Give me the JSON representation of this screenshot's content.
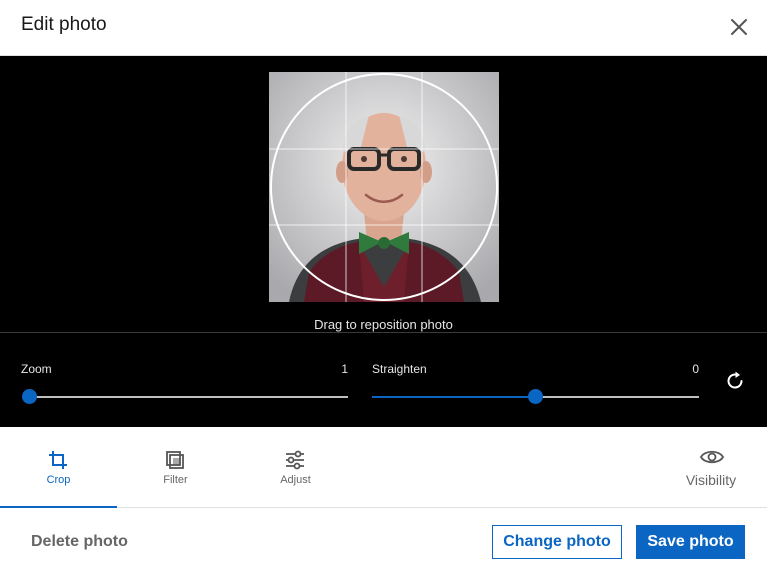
{
  "header": {
    "title": "Edit photo",
    "close_icon": "close-icon"
  },
  "editor": {
    "drag_hint": "Drag to reposition photo",
    "zoom": {
      "label": "Zoom",
      "value": "1",
      "fraction": 0.0
    },
    "straighten": {
      "label": "Straighten",
      "value": "0",
      "fraction": 0.5
    },
    "reset_icon": "rotate-reset-icon"
  },
  "tabs": {
    "items": [
      {
        "label": "Crop",
        "icon": "crop-icon",
        "active": true
      },
      {
        "label": "Filter",
        "icon": "filter-icon",
        "active": false
      },
      {
        "label": "Adjust",
        "icon": "adjust-sliders-icon",
        "active": false
      }
    ],
    "visibility": {
      "label": "Visibility",
      "icon": "eye-icon"
    }
  },
  "footer": {
    "delete_label": "Delete photo",
    "change_label": "Change photo",
    "save_label": "Save photo"
  },
  "colors": {
    "accent": "#0a66c2",
    "editor_bg": "#000000",
    "muted_text": "#666666"
  }
}
